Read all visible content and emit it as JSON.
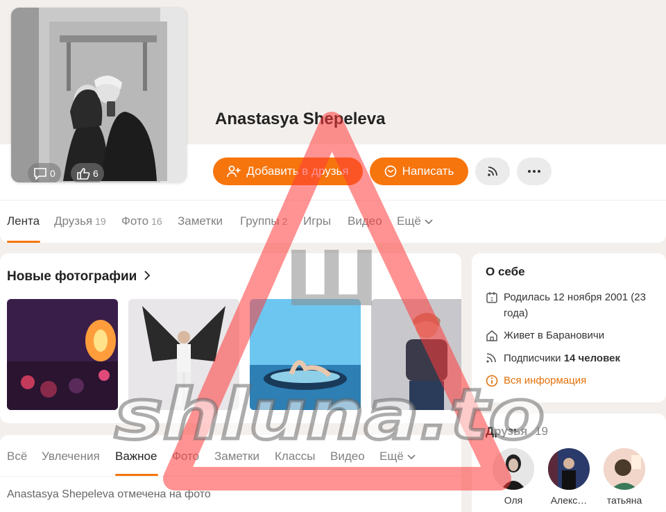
{
  "profile": {
    "name": "Anastasya Shepeleva",
    "comments_count": "0",
    "likes_count": "6"
  },
  "actions": {
    "add_friend": "Добавить в друзья",
    "message": "Написать",
    "subscribe_icon": "rss-icon",
    "more_icon": "ellipsis-icon"
  },
  "nav": {
    "items": [
      {
        "label": "Лента",
        "count": ""
      },
      {
        "label": "Друзья",
        "count": "19"
      },
      {
        "label": "Фото",
        "count": "16"
      },
      {
        "label": "Заметки",
        "count": ""
      },
      {
        "label": "Группы",
        "count": "2"
      },
      {
        "label": "Игры",
        "count": ""
      },
      {
        "label": "Видео",
        "count": ""
      },
      {
        "label": "Ещё",
        "count": ""
      }
    ]
  },
  "photos": {
    "title": "Новые фотографии"
  },
  "feed": {
    "tabs": [
      "Всё",
      "Увлечения",
      "Важное",
      "Фото",
      "Заметки",
      "Классы",
      "Видео",
      "Ещё"
    ],
    "first_item": "Anastasya Shepeleva отмечена на фото"
  },
  "about": {
    "title": "О себе",
    "birth": "Родилась 12 ноября 2001 (23",
    "birth_line2": "года)",
    "city": "Живет в Барановичи",
    "followers_prefix": "Подписчики",
    "followers": "14 человек",
    "more_info": "Вся информация"
  },
  "friends": {
    "title": "Друзья",
    "count": "19",
    "list": [
      "Оля",
      "Алекс…",
      "татьяна"
    ]
  },
  "watermark": {
    "text": "shluna.to",
    "letter": "Ш"
  },
  "colors": {
    "accent": "#f7750d",
    "watermark_red": "#ff3a3a"
  }
}
